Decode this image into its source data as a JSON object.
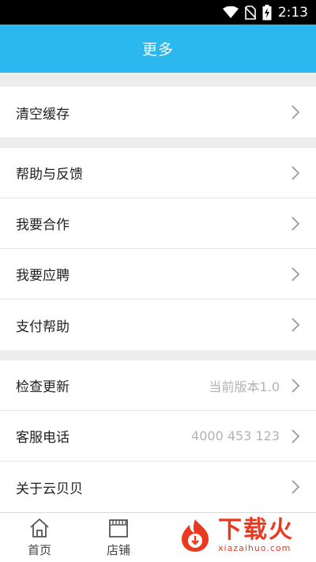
{
  "status_bar": {
    "time": "2:13",
    "icons": [
      "wifi-icon",
      "no-sim-icon",
      "battery-charging-icon"
    ]
  },
  "header": {
    "title": "更多"
  },
  "groups": [
    {
      "items": [
        {
          "label": "清空缓存",
          "value": ""
        }
      ]
    },
    {
      "items": [
        {
          "label": "帮助与反馈",
          "value": ""
        },
        {
          "label": "我要合作",
          "value": ""
        },
        {
          "label": "我要应聘",
          "value": ""
        },
        {
          "label": "支付帮助",
          "value": ""
        }
      ]
    },
    {
      "items": [
        {
          "label": "检查更新",
          "value": "当前版本1.0"
        },
        {
          "label": "客服电话",
          "value": "4000 453 123"
        },
        {
          "label": "关于云贝贝",
          "value": ""
        }
      ]
    }
  ],
  "tab_bar": {
    "tabs": [
      {
        "label": "首页",
        "icon": "home-icon"
      },
      {
        "label": "店铺",
        "icon": "store-icon"
      }
    ]
  },
  "watermark": {
    "text": "下载火",
    "sub": "xiazaihuo.com"
  },
  "colors": {
    "accent": "#2ab8ee",
    "watermark": "#e93a1f"
  }
}
